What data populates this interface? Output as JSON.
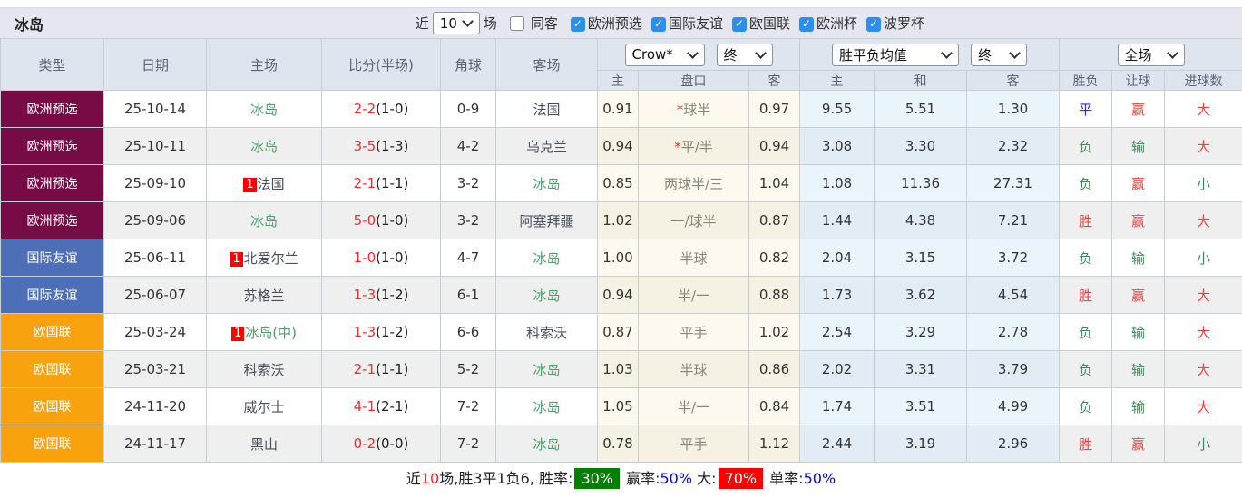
{
  "title": "冰岛",
  "toolbar": {
    "recent_label": "近",
    "recent_value": "10",
    "games_label": "场",
    "same_away_label": "同客",
    "same_away_checked": false,
    "competitions": [
      {
        "label": "欧洲预选",
        "checked": true
      },
      {
        "label": "国际友谊",
        "checked": true
      },
      {
        "label": "欧国联",
        "checked": true
      },
      {
        "label": "欧洲杯",
        "checked": true
      },
      {
        "label": "波罗杯",
        "checked": true
      }
    ]
  },
  "table": {
    "selects": {
      "bookmaker": "Crow*",
      "odds_time": "终",
      "mean_label": "胜平负均值",
      "mean_time": "终",
      "scope": "全场"
    },
    "headers": {
      "type": "类型",
      "date": "日期",
      "home": "主场",
      "score": "比分(半场)",
      "corners": "角球",
      "away": "客场",
      "odds_home": "主",
      "odds_line": "盘口",
      "odds_away": "客",
      "mean_home": "主",
      "mean_draw": "和",
      "mean_away": "客",
      "result": "胜负",
      "handicap": "让球",
      "goals": "进球数"
    },
    "rows": [
      {
        "type": "欧洲预选",
        "date": "25-10-14",
        "home": {
          "text": "冰岛",
          "green": true,
          "flag": false
        },
        "score": {
          "ft": "2-2",
          "ht": "(1-0)"
        },
        "corners": "0-9",
        "away": {
          "text": "法国",
          "green": false
        },
        "odds": {
          "home": "0.91",
          "star": true,
          "line": "球半",
          "away": "0.97"
        },
        "mean": {
          "home": "9.55",
          "draw": "5.51",
          "away": "1.30"
        },
        "result": {
          "text": "平",
          "c": "blue"
        },
        "handicap": {
          "text": "赢",
          "c": "red"
        },
        "goals": {
          "text": "大",
          "c": "red"
        }
      },
      {
        "type": "欧洲预选",
        "date": "25-10-11",
        "home": {
          "text": "冰岛",
          "green": true,
          "flag": false
        },
        "score": {
          "ft": "3-5",
          "ht": "(1-3)"
        },
        "corners": "4-2",
        "away": {
          "text": "乌克兰",
          "green": false
        },
        "odds": {
          "home": "0.94",
          "star": true,
          "line": "平/半",
          "away": "0.94"
        },
        "mean": {
          "home": "3.08",
          "draw": "3.30",
          "away": "2.32"
        },
        "result": {
          "text": "负",
          "c": "green"
        },
        "handicap": {
          "text": "输",
          "c": "green"
        },
        "goals": {
          "text": "大",
          "c": "red"
        }
      },
      {
        "type": "欧洲预选",
        "date": "25-09-10",
        "home": {
          "text": "法国",
          "green": false,
          "flag": true
        },
        "score": {
          "ft": "2-1",
          "ht": "(1-1)"
        },
        "corners": "3-2",
        "away": {
          "text": "冰岛",
          "green": true
        },
        "odds": {
          "home": "0.85",
          "star": false,
          "line": "两球半/三",
          "away": "1.04"
        },
        "mean": {
          "home": "1.08",
          "draw": "11.36",
          "away": "27.31"
        },
        "result": {
          "text": "负",
          "c": "green"
        },
        "handicap": {
          "text": "赢",
          "c": "red"
        },
        "goals": {
          "text": "小",
          "c": "green"
        }
      },
      {
        "type": "欧洲预选",
        "date": "25-09-06",
        "home": {
          "text": "冰岛",
          "green": true,
          "flag": false
        },
        "score": {
          "ft": "5-0",
          "ht": "(1-0)"
        },
        "corners": "3-2",
        "away": {
          "text": "阿塞拜疆",
          "green": false
        },
        "odds": {
          "home": "1.02",
          "star": false,
          "line": "一/球半",
          "away": "0.87"
        },
        "mean": {
          "home": "1.44",
          "draw": "4.38",
          "away": "7.21"
        },
        "result": {
          "text": "胜",
          "c": "red"
        },
        "handicap": {
          "text": "赢",
          "c": "red"
        },
        "goals": {
          "text": "大",
          "c": "red"
        }
      },
      {
        "type": "国际友谊",
        "date": "25-06-11",
        "home": {
          "text": "北爱尔兰",
          "green": false,
          "flag": true
        },
        "score": {
          "ft": "1-0",
          "ht": "(1-0)"
        },
        "corners": "4-7",
        "away": {
          "text": "冰岛",
          "green": true
        },
        "odds": {
          "home": "1.00",
          "star": false,
          "line": "半球",
          "away": "0.82"
        },
        "mean": {
          "home": "2.04",
          "draw": "3.15",
          "away": "3.72"
        },
        "result": {
          "text": "负",
          "c": "green"
        },
        "handicap": {
          "text": "输",
          "c": "green"
        },
        "goals": {
          "text": "小",
          "c": "green"
        }
      },
      {
        "type": "国际友谊",
        "date": "25-06-07",
        "home": {
          "text": "苏格兰",
          "green": false,
          "flag": false
        },
        "score": {
          "ft": "1-3",
          "ht": "(1-2)"
        },
        "corners": "6-1",
        "away": {
          "text": "冰岛",
          "green": true
        },
        "odds": {
          "home": "0.94",
          "star": false,
          "line": "半/一",
          "away": "0.88"
        },
        "mean": {
          "home": "1.73",
          "draw": "3.62",
          "away": "4.54"
        },
        "result": {
          "text": "胜",
          "c": "red"
        },
        "handicap": {
          "text": "赢",
          "c": "red"
        },
        "goals": {
          "text": "大",
          "c": "red"
        }
      },
      {
        "type": "欧国联",
        "date": "25-03-24",
        "home": {
          "text": "冰岛(中)",
          "green": true,
          "flag": true
        },
        "score": {
          "ft": "1-3",
          "ht": "(1-2)"
        },
        "corners": "6-6",
        "away": {
          "text": "科索沃",
          "green": false
        },
        "odds": {
          "home": "0.87",
          "star": false,
          "line": "平手",
          "away": "1.02"
        },
        "mean": {
          "home": "2.54",
          "draw": "3.29",
          "away": "2.78"
        },
        "result": {
          "text": "负",
          "c": "green"
        },
        "handicap": {
          "text": "输",
          "c": "green"
        },
        "goals": {
          "text": "大",
          "c": "red"
        }
      },
      {
        "type": "欧国联",
        "date": "25-03-21",
        "home": {
          "text": "科索沃",
          "green": false,
          "flag": false
        },
        "score": {
          "ft": "2-1",
          "ht": "(1-1)"
        },
        "corners": "5-2",
        "away": {
          "text": "冰岛",
          "green": true
        },
        "odds": {
          "home": "1.03",
          "star": false,
          "line": "半球",
          "away": "0.86"
        },
        "mean": {
          "home": "2.02",
          "draw": "3.31",
          "away": "3.79"
        },
        "result": {
          "text": "负",
          "c": "green"
        },
        "handicap": {
          "text": "输",
          "c": "green"
        },
        "goals": {
          "text": "大",
          "c": "red"
        }
      },
      {
        "type": "欧国联",
        "date": "24-11-20",
        "home": {
          "text": "威尔士",
          "green": false,
          "flag": false
        },
        "score": {
          "ft": "4-1",
          "ht": "(2-1)"
        },
        "corners": "7-2",
        "away": {
          "text": "冰岛",
          "green": true
        },
        "odds": {
          "home": "1.05",
          "star": false,
          "line": "半/一",
          "away": "0.84"
        },
        "mean": {
          "home": "1.74",
          "draw": "3.51",
          "away": "4.99"
        },
        "result": {
          "text": "负",
          "c": "green"
        },
        "handicap": {
          "text": "输",
          "c": "green"
        },
        "goals": {
          "text": "大",
          "c": "red"
        }
      },
      {
        "type": "欧国联",
        "date": "24-11-17",
        "home": {
          "text": "黑山",
          "green": false,
          "flag": false
        },
        "score": {
          "ft": "0-2",
          "ht": "(0-0)"
        },
        "corners": "7-2",
        "away": {
          "text": "冰岛",
          "green": true
        },
        "odds": {
          "home": "0.78",
          "star": false,
          "line": "平手",
          "away": "1.12"
        },
        "mean": {
          "home": "2.44",
          "draw": "3.19",
          "away": "2.96"
        },
        "result": {
          "text": "胜",
          "c": "red"
        },
        "handicap": {
          "text": "赢",
          "c": "red"
        },
        "goals": {
          "text": "小",
          "c": "green"
        }
      }
    ]
  },
  "footer": {
    "segments": [
      {
        "t": "近"
      },
      {
        "t": "10",
        "c": "red"
      },
      {
        "t": "场,胜3平1负6, 胜率:"
      },
      {
        "t": "30%",
        "badge": "green"
      },
      {
        "t": " 赢率:"
      },
      {
        "t": "50%",
        "c": "blue"
      },
      {
        "t": " 大:"
      },
      {
        "t": "70%",
        "badge": "red"
      },
      {
        "t": " 单率:"
      },
      {
        "t": "50%",
        "c": "blue"
      }
    ]
  },
  "colors": {
    "competition_bg": {
      "欧洲预选": "#770b45",
      "国际友谊": "#4c6fb7",
      "欧国联": "#f8a30d"
    },
    "team_green": "#4d9f68",
    "score_red": "#f22c2c",
    "result_red": "#f0413e",
    "result_green": "#41885a",
    "result_blue": "#2929d6",
    "badge_green": "#008000",
    "badge_red": "#fe0000",
    "link_blue": "#0000f0",
    "checkbox_blue": "#2b8ff0",
    "header_bg": "#dfe5ef",
    "titlebar_bg": "#e6e6f0",
    "cream_col_bg": "#fdf9ee",
    "blue_col_bg": "#eaf4fb"
  }
}
